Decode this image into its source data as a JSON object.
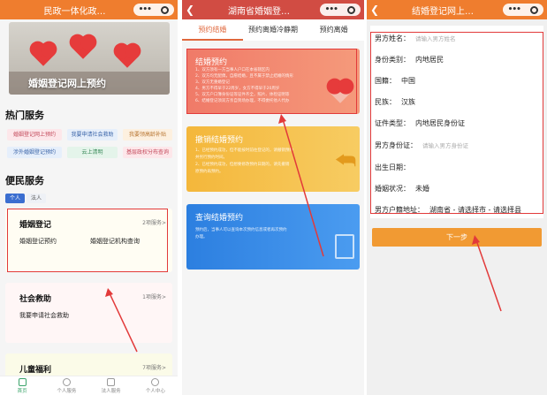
{
  "screen1": {
    "title": "民政一体化政…",
    "banner_text": "婚姻登记网上预约",
    "hot_services_title": "热门服务",
    "hot_services": [
      {
        "label": "婚姻登记网上预约"
      },
      {
        "label": "我要申请社会救助"
      },
      {
        "label": "我要领高龄补贴"
      },
      {
        "label": "涉外婚姻登记预约"
      },
      {
        "label": "云上清明"
      },
      {
        "label": "基层政权分布查询"
      }
    ],
    "people_services_title": "便民服务",
    "segments": [
      "个人",
      "法人"
    ],
    "cards": [
      {
        "title": "婚姻登记",
        "more": "2项服务>",
        "items": [
          "婚姻登记预约",
          "婚姻登记机构查询"
        ]
      },
      {
        "title": "社会救助",
        "more": "1项服务>",
        "items": [
          "我要申请社会救助"
        ]
      },
      {
        "title": "儿童福利",
        "more": "7项服务>",
        "items": []
      }
    ],
    "tabbar": [
      "首页",
      "个人服务",
      "法人服务",
      "个人中心"
    ]
  },
  "screen2": {
    "title": "湖南省婚姻登…",
    "tabs": [
      "预约结婚",
      "预约离婚冷静期",
      "预约离婚"
    ],
    "cards": [
      {
        "title": "结婚预约",
        "lines": [
          "1、双方须有一方当事人户口在本省辖区内",
          "2、双方均无配偶，自愿结婚，且不属于禁止结婚的情形",
          "3、双方无重婚登记",
          "4、男方不得早于22周岁，女方不得早于20周岁",
          "5、双方户口簿身份证等证件齐全，照片、体检证明等",
          "6、结婚登记须双方亲自到场办理，不得委托他人代办"
        ]
      },
      {
        "title": "撤销结婚预约",
        "lines": [
          "1、已经预约成功，但不能按时前往登记的，请撤销预约",
          "并另行预约时间。",
          "2、已经预约成功，但想要修改预约日期的，请先撤销",
          "原预约再预约。"
        ]
      },
      {
        "title": "查询结婚预约",
        "lines": [
          "预约后，当事人可以查询本次预约信息或者再次预约",
          "办理。"
        ]
      }
    ]
  },
  "screen3": {
    "title": "结婚登记网上…",
    "fields": [
      {
        "label": "男方姓名：",
        "placeholder": "请输入男方姓名",
        "value": ""
      },
      {
        "label": "身份类别：",
        "placeholder": "",
        "value": "内地居民"
      },
      {
        "label": "国籍：",
        "placeholder": "",
        "value": "中国"
      },
      {
        "label": "民族：",
        "placeholder": "",
        "value": "汉族"
      },
      {
        "label": "证件类型：",
        "placeholder": "",
        "value": "内地居民身份证"
      },
      {
        "label": "男方身份证：",
        "placeholder": "请输入男方身份证",
        "value": ""
      },
      {
        "label": "出生日期：",
        "placeholder": "",
        "value": ""
      },
      {
        "label": "婚姻状况：",
        "placeholder": "",
        "value": "未婚"
      },
      {
        "label": "男方户籍地址：",
        "placeholder": "",
        "value": "湖南省 - 请选择市 - 请选择县"
      }
    ],
    "next_button": "下一步"
  },
  "colors": {
    "topbar_orange": "#ef7d2e",
    "topbar_red": "#d14c43",
    "annotation_red": "#e23a3a",
    "button_orange": "#f19a33"
  }
}
